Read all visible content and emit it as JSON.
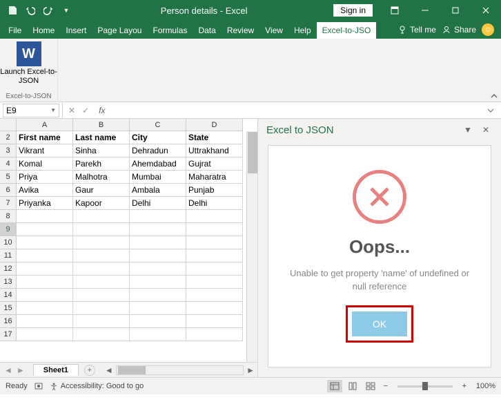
{
  "titlebar": {
    "title": "Person details - Excel",
    "signin": "Sign in"
  },
  "tabs": {
    "items": [
      "File",
      "Home",
      "Insert",
      "Page Layou",
      "Formulas",
      "Data",
      "Review",
      "View",
      "Help",
      "Excel-to-JSO"
    ],
    "active_index": 9,
    "tell_me": "Tell me",
    "share": "Share"
  },
  "ribbon": {
    "launch_label": "Launch Excel-to-JSON",
    "group_name": "Excel-to-JSON"
  },
  "formula_bar": {
    "name_box": "E9",
    "fx": "fx",
    "formula": ""
  },
  "grid": {
    "columns": [
      "A",
      "B",
      "C",
      "D"
    ],
    "row_start": 2,
    "row_count": 16,
    "active_row": 9,
    "headers": [
      "First name",
      "Last name",
      "City",
      "State"
    ],
    "rows": [
      [
        "Vikrant",
        "Sinha",
        "Dehradun",
        "Uttrakhand"
      ],
      [
        "Komal",
        "Parekh",
        "Ahemdabad",
        "Gujrat"
      ],
      [
        "Priya",
        "Malhotra",
        "Mumbai",
        "Maharatra"
      ],
      [
        "Avika",
        "Gaur",
        "Ambala",
        "Punjab"
      ],
      [
        "Priyanka",
        "Kapoor",
        "Delhi",
        "Delhi"
      ]
    ]
  },
  "sheet_tabs": {
    "active": "Sheet1"
  },
  "taskpane": {
    "title": "Excel to JSON",
    "oops": "Oops...",
    "message": "Unable to get property 'name' of undefined or null reference",
    "ok": "OK"
  },
  "statusbar": {
    "ready": "Ready",
    "accessibility": "Accessibility: Good to go",
    "zoom": "100%"
  }
}
